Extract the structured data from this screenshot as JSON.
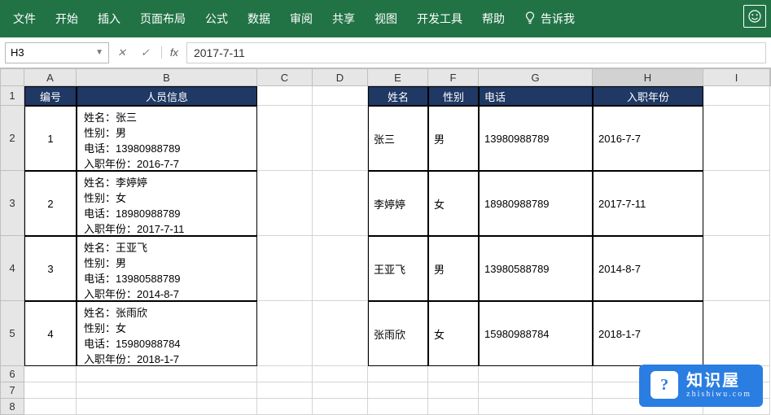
{
  "ribbon": {
    "tabs": [
      "文件",
      "开始",
      "插入",
      "页面布局",
      "公式",
      "数据",
      "审阅",
      "共享",
      "视图",
      "开发工具",
      "帮助"
    ],
    "tell_me": "告诉我"
  },
  "formula_bar": {
    "name_box": "H3",
    "formula": "2017-7-11",
    "fx": "fx",
    "cancel": "✕",
    "confirm": "✓"
  },
  "columns": [
    "A",
    "B",
    "C",
    "D",
    "E",
    "F",
    "G",
    "H",
    "I"
  ],
  "row_nums": [
    "1",
    "2",
    "3",
    "4",
    "5",
    "6",
    "7",
    "8"
  ],
  "left_table": {
    "headers": {
      "a": "编号",
      "b": "人员信息"
    },
    "rows": [
      {
        "num": "1",
        "info": [
          "姓名：张三",
          "性别：男",
          "电话：13980988789",
          "入职年份：2016-7-7"
        ]
      },
      {
        "num": "2",
        "info": [
          "姓名：李婷婷",
          "性别：女",
          "电话：18980988789",
          "入职年份：2017-7-11"
        ]
      },
      {
        "num": "3",
        "info": [
          "姓名：王亚飞",
          "性别：男",
          "电话：13980588789",
          "入职年份：2014-8-7"
        ]
      },
      {
        "num": "4",
        "info": [
          "姓名：张雨欣",
          "性别：女",
          "电话：15980988784",
          "入职年份：2018-1-7"
        ]
      }
    ]
  },
  "right_table": {
    "headers": {
      "e": "姓名",
      "f": "性别",
      "g": "电话",
      "h": "入职年份"
    },
    "rows": [
      {
        "name": "张三",
        "gender": "男",
        "phone": "13980988789",
        "date": "2016-7-7"
      },
      {
        "name": "李婷婷",
        "gender": "女",
        "phone": "18980988789",
        "date": "2017-7-11"
      },
      {
        "name": "王亚飞",
        "gender": "男",
        "phone": "13980588789",
        "date": "2014-8-7"
      },
      {
        "name": "张雨欣",
        "gender": "女",
        "phone": "15980988784",
        "date": "2018-1-7"
      }
    ]
  },
  "watermark": {
    "cn": "知识屋",
    "en": "zhishiwu.com",
    "q": "?"
  }
}
